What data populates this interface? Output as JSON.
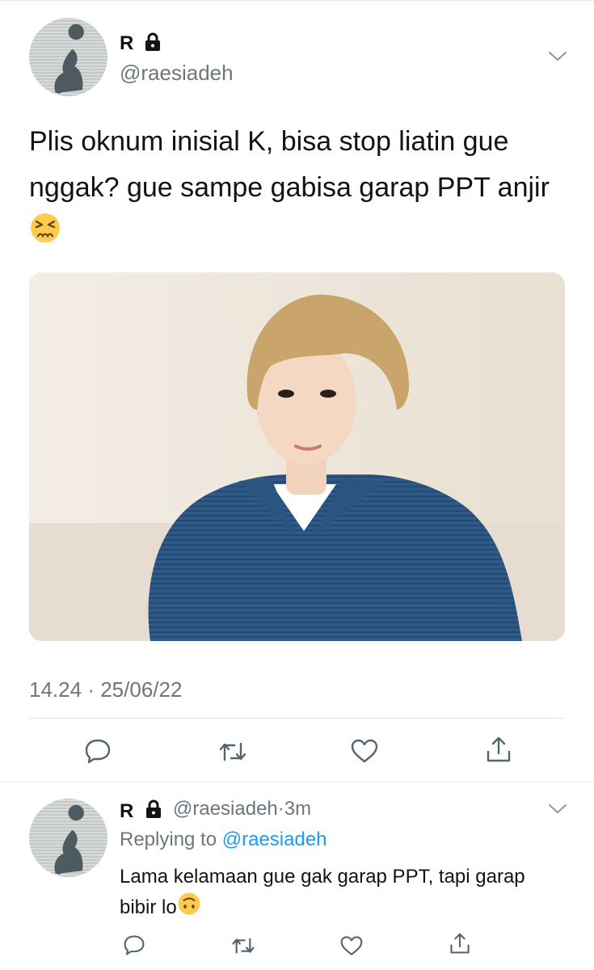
{
  "main_tweet": {
    "name": "R",
    "handle": "@raesiadeh",
    "text": "Plis oknum inisial K, bisa stop liatin gue nggak? gue sampe gabisa garap PPT anjir",
    "emoji": "😣",
    "time": "14.24",
    "date": "25/06/22",
    "meta_separator": "·",
    "icons": [
      "lock-icon",
      "chevron-down-icon",
      "reply-icon",
      "retweet-icon",
      "like-icon",
      "share-icon"
    ]
  },
  "reply_tweet": {
    "name": "R",
    "handle": "@raesiadeh",
    "separator": "·",
    "age": "3m",
    "replying_prefix": "Replying to",
    "replying_handle": "@raesiadeh",
    "text": "Lama kelamaan gue gak garap PPT, tapi garap bibir lo",
    "emoji": "🙃"
  },
  "colors": {
    "text": "#0f1419",
    "muted": "#6e767d",
    "link": "#1d9bf0",
    "divider": "#e1e8ed"
  }
}
